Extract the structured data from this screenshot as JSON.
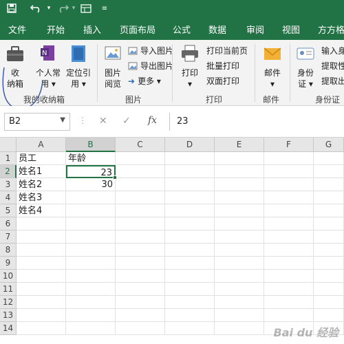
{
  "quick_access": {
    "save_icon": "save-icon",
    "undo_icon": "undo-icon",
    "redo_icon": "redo-icon",
    "form_icon": "form-icon",
    "customize_icon": "customize-icon"
  },
  "tabs": [
    "文件",
    "开始",
    "插入",
    "页面布局",
    "公式",
    "数据",
    "审阅",
    "视图",
    "方方格"
  ],
  "ribbon": {
    "group1": {
      "btn_collect": "收\n纳箱",
      "btn_personal": "个人常\n用 ▾",
      "btn_locate": "定位引\n用 ▾",
      "label": "我的收纳箱"
    },
    "group2": {
      "btn_browse": "图片\n阅览",
      "import_img": "导入图片",
      "export_img": "导出图片",
      "more": "更多 ▾",
      "label": "图片"
    },
    "group3": {
      "btn_print": "打印\n▾",
      "print_current": "打印当前页",
      "batch_print": "批量打印",
      "duplex_print": "双面打印",
      "label": "打印"
    },
    "group4": {
      "btn_mail": "邮件\n▾",
      "label": "邮件"
    },
    "group5": {
      "btn_id": "身份\n证 ▾",
      "input_id": "输入身",
      "extract1": "提取性",
      "extract2": "提取出",
      "label": "身份证"
    }
  },
  "formula_bar": {
    "name_box": "B2",
    "fx": "fx",
    "value": "23"
  },
  "grid": {
    "columns": [
      "A",
      "B",
      "C",
      "D",
      "E",
      "F",
      "G"
    ],
    "rows": [
      "1",
      "2",
      "3",
      "4",
      "5",
      "6",
      "7",
      "8",
      "9",
      "10",
      "11",
      "12",
      "13",
      "14"
    ],
    "cells": {
      "A1": "员工",
      "B1": "年龄",
      "A2": "姓名1",
      "B2": "23",
      "A3": "姓名2",
      "B3": "30",
      "A4": "姓名3",
      "A5": "姓名4"
    },
    "selected": "B2"
  },
  "watermark": "Bai du 经验",
  "colors": {
    "accent": "#217346"
  }
}
